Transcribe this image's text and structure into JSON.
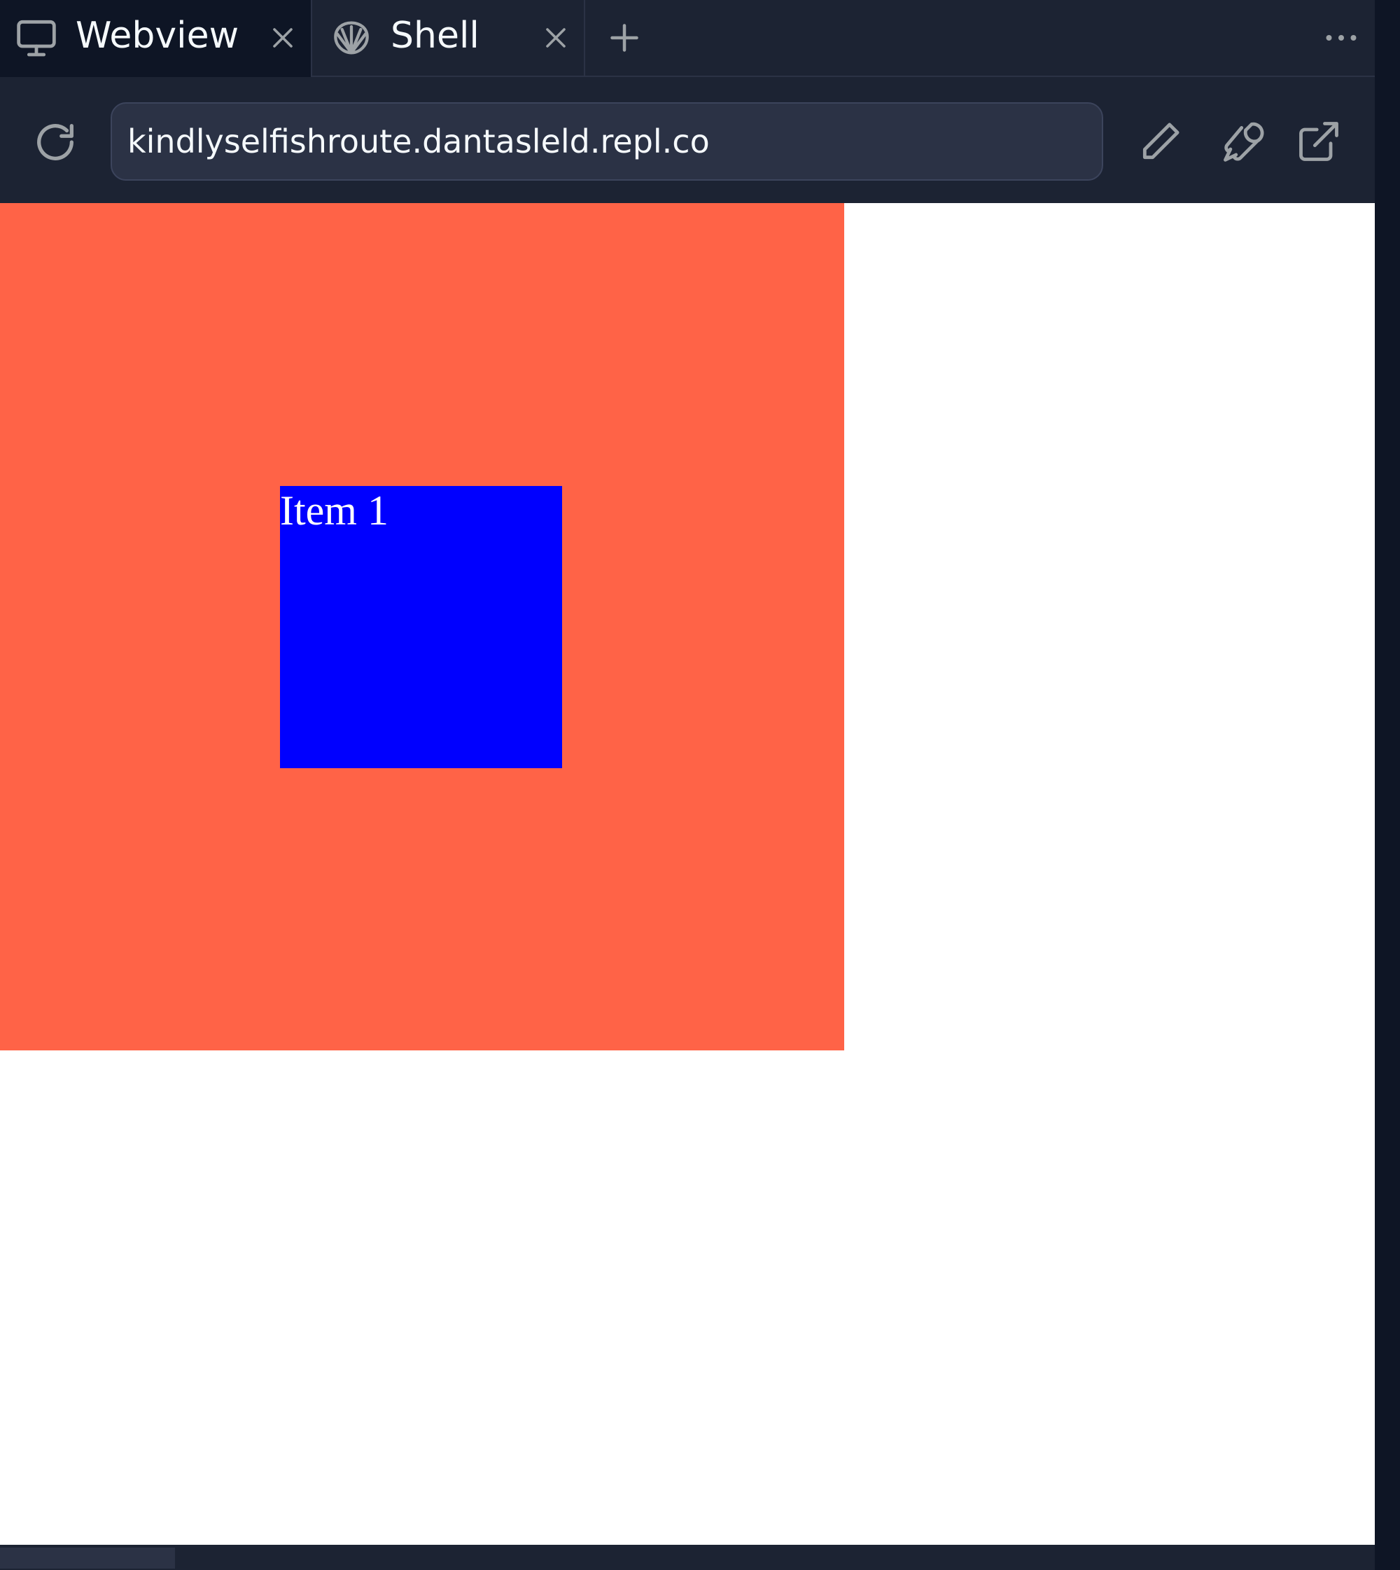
{
  "tabs": [
    {
      "label": "Webview",
      "icon": "monitor-icon",
      "active": true
    },
    {
      "label": "Shell",
      "icon": "shell-icon",
      "active": false
    }
  ],
  "tabbar": {
    "new_tab_icon": "plus-icon",
    "more_icon": "more-horizontal-icon"
  },
  "urlbar": {
    "url": "kindlyselfishroute.dantasleld.repl.co",
    "reload_icon": "reload-icon",
    "actions": [
      "pencil-icon",
      "wrench-icon",
      "external-link-icon"
    ]
  },
  "webview": {
    "container_color": "#ff6347",
    "item": {
      "label": "Item 1",
      "color": "#0000ff",
      "text_color": "#ffffff"
    }
  },
  "theme": {
    "chrome_bg": "#1c2333",
    "active_tab_bg": "#0e1525",
    "text": "#f5f9fc",
    "icon": "#9da2a6"
  }
}
